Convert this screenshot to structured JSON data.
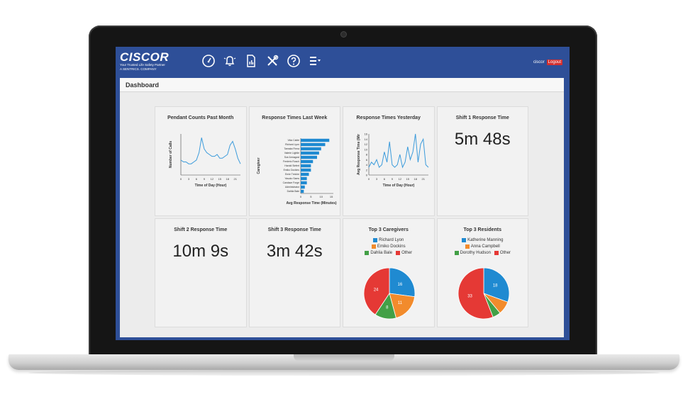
{
  "app": {
    "logo_text": "CISCOR",
    "tagline": "Your Trusted Life Safety Partner",
    "subline": "A SENTRICS. COMPANY",
    "user": "ciscor",
    "logout_label": "Logout",
    "nav_icons": [
      "gauge-icon",
      "bell-icon",
      "report-icon",
      "tools-icon",
      "help-icon",
      "menu-icon"
    ]
  },
  "page": {
    "title": "Dashboard"
  },
  "colors": {
    "nav_bg": "#2e4f98",
    "bar": "#1f8ad1",
    "line": "#3b9bdb",
    "red": "#e53935",
    "orange": "#f28b2c",
    "green": "#43a047",
    "blue": "#1f8ad1"
  },
  "cards": {
    "pendant": {
      "title": "Pendant Counts Past Month",
      "chart_data": {
        "type": "line",
        "xlabel": "Time of Day (Hour)",
        "ylabel": "Number of Calls",
        "x_ticks": [
          "0",
          "3",
          "6",
          "9",
          "12",
          "15",
          "18",
          "21"
        ],
        "x": [
          0,
          1,
          2,
          3,
          4,
          5,
          6,
          7,
          8,
          9,
          10,
          11,
          12,
          13,
          14,
          15,
          16,
          17,
          18,
          19,
          20,
          21,
          22,
          23
        ],
        "y": [
          8,
          7,
          7,
          6,
          6,
          7,
          8,
          12,
          20,
          14,
          12,
          11,
          10,
          10,
          11,
          9,
          9,
          10,
          11,
          16,
          18,
          14,
          9,
          6
        ]
      }
    },
    "response_week": {
      "title": "Response Times Last Week",
      "chart_data": {
        "type": "bar",
        "orientation": "horizontal",
        "xlabel": "Avg Response Time (Minutes)",
        "ylabel": "Caregiver",
        "x_ticks": [
          "0",
          "5",
          "10",
          "15"
        ],
        "categories": [
          "Vida Cable",
          "Richard Lyon",
          "Tamaka Firma",
          "Valerie Lightle",
          "Sue Armagost",
          "Frederic Rusch",
          "Harold Siefert",
          "Emiko Dockins",
          "Ernie Treiche",
          "Yasuko Sams",
          "Candace Forge",
          "Administrator",
          "Dahlia Bale"
        ],
        "values": [
          14,
          12,
          10,
          9,
          8,
          6,
          5,
          5,
          4,
          3,
          3,
          2,
          1.5
        ]
      }
    },
    "response_yesterday": {
      "title": "Response Times Yesterday",
      "chart_data": {
        "type": "line",
        "xlabel": "Time of Day (Hour)",
        "ylabel": "Avg Response Time (Mir",
        "y_ticks": [
          "0",
          "2",
          "4",
          "6",
          "8",
          "10",
          "12",
          "14",
          "16"
        ],
        "x_ticks": [
          "0",
          "3",
          "6",
          "9",
          "12",
          "15",
          "18",
          "21"
        ],
        "x": [
          0,
          1,
          2,
          3,
          4,
          5,
          6,
          7,
          8,
          9,
          10,
          11,
          12,
          13,
          14,
          15,
          16,
          17,
          18,
          19,
          20,
          21,
          22,
          23
        ],
        "y": [
          3,
          5,
          4,
          6,
          3,
          4,
          9,
          5,
          13,
          4,
          3,
          4,
          8,
          3,
          5,
          11,
          6,
          9,
          16,
          5,
          12,
          14,
          4,
          3
        ]
      }
    },
    "shift1": {
      "title": "Shift 1 Response Time",
      "value": "5m 48s"
    },
    "shift2": {
      "title": "Shift 2 Response Time",
      "value": "10m 9s"
    },
    "shift3": {
      "title": "Shift 3 Response Time",
      "value": "3m 42s"
    },
    "caregivers": {
      "title": "Top 3 Caregivers",
      "chart_data": {
        "type": "pie",
        "legend": [
          "Richard Lyon",
          "Emiko Dockins",
          "Dahlia Bale",
          "Other"
        ],
        "values": [
          16,
          11,
          8,
          24
        ],
        "colors": [
          "#1f8ad1",
          "#f28b2c",
          "#43a047",
          "#e53935"
        ],
        "labels": [
          "16",
          "11",
          "8",
          "24"
        ]
      }
    },
    "residents": {
      "title": "Top 3 Residents",
      "chart_data": {
        "type": "pie",
        "legend": [
          "Katherine Manning",
          "Anna Campbell",
          "Dorothy Hudson",
          "Other"
        ],
        "values": [
          18,
          5,
          3,
          33
        ],
        "colors": [
          "#1f8ad1",
          "#f28b2c",
          "#43a047",
          "#e53935"
        ],
        "labels": [
          "18",
          "",
          "",
          "33"
        ]
      }
    }
  }
}
